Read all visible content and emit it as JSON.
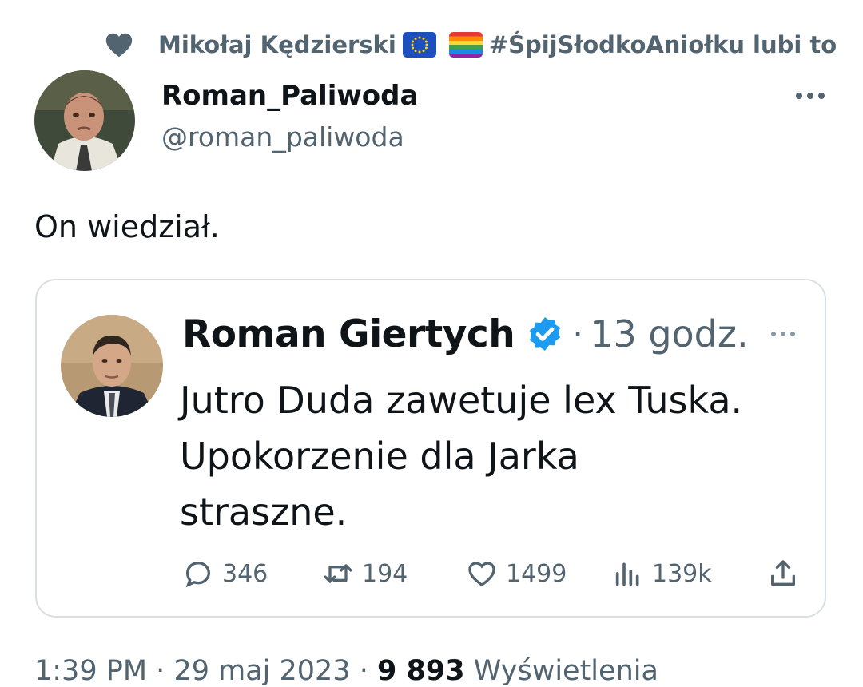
{
  "context": {
    "liked_by": "Mikołaj Kędzierski",
    "hashtag": "#ŚpijSłodkoAniołku",
    "suffix": "lubi to",
    "icons": [
      "heart-icon",
      "eu-flag-emoji",
      "rainbow-flag-emoji"
    ]
  },
  "author": {
    "display_name": "Roman_Paliwoda",
    "handle": "@roman_paliwoda"
  },
  "tweet": {
    "text": "On wiedział."
  },
  "quoted": {
    "display_name": "Roman Giertych",
    "verified": true,
    "separator": "·",
    "time": "13 godz.",
    "lines": [
      "Jutro Duda zawetuje lex Tuska.",
      "Upokorzenie dla Jarka",
      "straszne."
    ],
    "actions": {
      "replies": "346",
      "retweets": "194",
      "likes": "1499",
      "views": "139k"
    }
  },
  "meta": {
    "time": "1:39 PM",
    "sep1": "·",
    "date": "29 maj 2023",
    "sep2": "·",
    "views_count": "9 893",
    "views_label": "Wyświetlenia"
  },
  "colors": {
    "text": "#0f1419",
    "secondary": "#536471",
    "verified": "#1d9bf0",
    "border": "#dadfe3"
  }
}
